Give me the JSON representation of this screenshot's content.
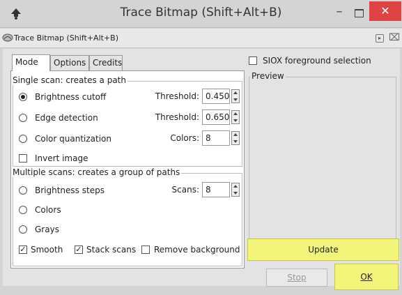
{
  "window": {
    "title": "Trace Bitmap (Shift+Alt+B)"
  },
  "dialog": {
    "title": "Trace Bitmap (Shift+Alt+B)"
  },
  "tabs": [
    {
      "label": "Mode"
    },
    {
      "label": "Options"
    },
    {
      "label": "Credits"
    }
  ],
  "single_scan": {
    "group_label": "Single scan: creates a path",
    "brightness": {
      "label": "Brightness cutoff",
      "selected": true,
      "field_label": "Threshold:",
      "value": "0.450"
    },
    "edge": {
      "label": "Edge detection",
      "selected": false,
      "field_label": "Threshold:",
      "value": "0.650"
    },
    "color_quant": {
      "label": "Color quantization",
      "selected": false,
      "field_label": "Colors:",
      "value": "8"
    },
    "invert": {
      "label": "Invert image",
      "checked": false
    }
  },
  "multi_scan": {
    "group_label": "Multiple scans: creates a group of paths",
    "brightness_steps": {
      "label": "Brightness steps",
      "selected": false,
      "field_label": "Scans:",
      "value": "8"
    },
    "colors": {
      "label": "Colors",
      "selected": false
    },
    "grays": {
      "label": "Grays",
      "selected": false
    },
    "smooth": {
      "label": "Smooth",
      "checked": true
    },
    "stack": {
      "label": "Stack scans",
      "checked": true
    },
    "remove_bg": {
      "label": "Remove background",
      "checked": false
    }
  },
  "siox": {
    "label": "SIOX foreground selection",
    "checked": false
  },
  "preview": {
    "label": "Preview"
  },
  "buttons": {
    "update": "Update",
    "stop": "Stop",
    "ok": "OK"
  },
  "colors": {
    "highlight": "#f3f57a",
    "close": "#e04343"
  }
}
